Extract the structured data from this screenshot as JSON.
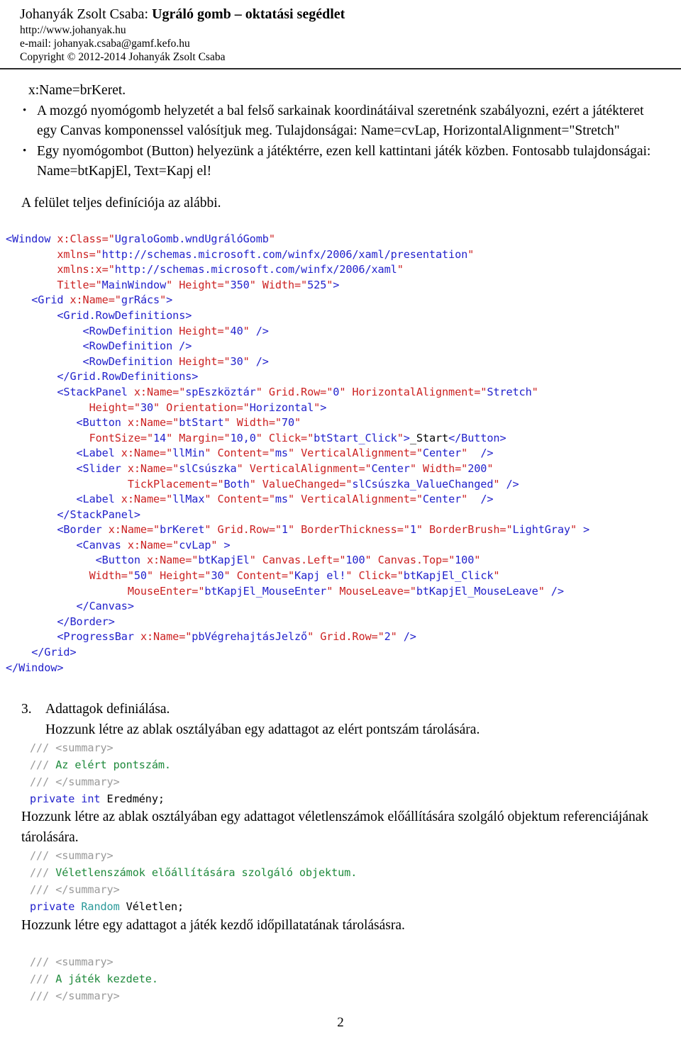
{
  "header": {
    "title_normal": "Johanyák Zsolt Csaba: ",
    "title_bold": "Ugráló gomb – oktatási segédlet",
    "website": "http://www.johanyak.hu",
    "email": "e-mail: johanyak.csaba@gamf.kefo.hu",
    "copyright": "Copyright © 2012-2014 Johanyák Zsolt Csaba"
  },
  "body": {
    "lead_line": "x:Name=brKeret.",
    "bullets": [
      "A mozgó nyomógomb helyzetét a bal felső sarkainak koordinátáival szeretnénk szabályozni, ezért a játékteret egy Canvas komponenssel valósítjuk meg. Tulajdonságai: Name=cvLap, HorizontalAlignment=\"Stretch\"",
      "Egy nyomógombot (Button) helyezünk a játéktérre, ezen kell kattintani játék közben. Fontosabb tulajdonságai: Name=btKapjEl, Text=Kapj el!"
    ],
    "after_bullets": "A felület teljes definíciója az alábbi."
  },
  "xaml": {
    "lines": [
      [
        [
          "tag",
          "<Window "
        ],
        [
          "attr",
          "x:Class=\""
        ],
        [
          "val",
          "UgraloGomb.wndUgrálóGomb"
        ],
        [
          "attr",
          "\""
        ]
      ],
      [
        [
          "plain",
          "        "
        ],
        [
          "attr",
          "xmlns=\""
        ],
        [
          "val",
          "http://schemas.microsoft.com/winfx/2006/xaml/presentation"
        ],
        [
          "attr",
          "\""
        ]
      ],
      [
        [
          "plain",
          "        "
        ],
        [
          "attr",
          "xmlns:x=\""
        ],
        [
          "val",
          "http://schemas.microsoft.com/winfx/2006/xaml"
        ],
        [
          "attr",
          "\""
        ]
      ],
      [
        [
          "plain",
          "        "
        ],
        [
          "attr",
          "Title=\""
        ],
        [
          "val",
          "MainWindow"
        ],
        [
          "attr",
          "\" "
        ],
        [
          "attr",
          "Height=\""
        ],
        [
          "val",
          "350"
        ],
        [
          "attr",
          "\" "
        ],
        [
          "attr",
          "Width=\""
        ],
        [
          "val",
          "525"
        ],
        [
          "attr",
          "\""
        ],
        [
          "tag",
          ">"
        ]
      ],
      [
        [
          "plain",
          "    "
        ],
        [
          "tag",
          "<Grid "
        ],
        [
          "attr",
          "x:Name=\""
        ],
        [
          "val",
          "grRács"
        ],
        [
          "attr",
          "\""
        ],
        [
          "tag",
          ">"
        ]
      ],
      [
        [
          "plain",
          "        "
        ],
        [
          "tag",
          "<Grid.RowDefinitions>"
        ]
      ],
      [
        [
          "plain",
          "            "
        ],
        [
          "tag",
          "<RowDefinition "
        ],
        [
          "attr",
          "Height=\""
        ],
        [
          "val",
          "40"
        ],
        [
          "attr",
          "\" "
        ],
        [
          "tag",
          "/>"
        ]
      ],
      [
        [
          "plain",
          "            "
        ],
        [
          "tag",
          "<RowDefinition />"
        ]
      ],
      [
        [
          "plain",
          "            "
        ],
        [
          "tag",
          "<RowDefinition "
        ],
        [
          "attr",
          "Height=\""
        ],
        [
          "val",
          "30"
        ],
        [
          "attr",
          "\" "
        ],
        [
          "tag",
          "/>"
        ]
      ],
      [
        [
          "plain",
          "        "
        ],
        [
          "tag",
          "</Grid.RowDefinitions>"
        ]
      ],
      [
        [
          "plain",
          "        "
        ],
        [
          "tag",
          "<StackPanel "
        ],
        [
          "attr",
          "x:Name=\""
        ],
        [
          "val",
          "spEszköztár"
        ],
        [
          "attr",
          "\" "
        ],
        [
          "attr",
          "Grid.Row=\""
        ],
        [
          "val",
          "0"
        ],
        [
          "attr",
          "\" "
        ],
        [
          "attr",
          "HorizontalAlignment=\""
        ],
        [
          "val",
          "Stretch"
        ],
        [
          "attr",
          "\""
        ]
      ],
      [
        [
          "plain",
          "             "
        ],
        [
          "attr",
          "Height=\""
        ],
        [
          "val",
          "30"
        ],
        [
          "attr",
          "\" "
        ],
        [
          "attr",
          "Orientation=\""
        ],
        [
          "val",
          "Horizontal"
        ],
        [
          "attr",
          "\""
        ],
        [
          "tag",
          ">"
        ]
      ],
      [
        [
          "plain",
          "           "
        ],
        [
          "tag",
          "<Button "
        ],
        [
          "attr",
          "x:Name=\""
        ],
        [
          "val",
          "btStart"
        ],
        [
          "attr",
          "\" "
        ],
        [
          "attr",
          "Width=\""
        ],
        [
          "val",
          "70"
        ],
        [
          "attr",
          "\""
        ]
      ],
      [
        [
          "plain",
          "             "
        ],
        [
          "attr",
          "FontSize=\""
        ],
        [
          "val",
          "14"
        ],
        [
          "attr",
          "\" "
        ],
        [
          "attr",
          "Margin=\""
        ],
        [
          "val",
          "10,0"
        ],
        [
          "attr",
          "\" "
        ],
        [
          "attr",
          "Click=\""
        ],
        [
          "val",
          "btStart_Click"
        ],
        [
          "attr",
          "\""
        ],
        [
          "tag",
          ">"
        ],
        [
          "txt",
          "_Start"
        ],
        [
          "tag",
          "</Button>"
        ]
      ],
      [
        [
          "plain",
          "           "
        ],
        [
          "tag",
          "<Label "
        ],
        [
          "attr",
          "x:Name=\""
        ],
        [
          "val",
          "llMin"
        ],
        [
          "attr",
          "\" "
        ],
        [
          "attr",
          "Content=\""
        ],
        [
          "val",
          "ms"
        ],
        [
          "attr",
          "\" "
        ],
        [
          "attr",
          "VerticalAlignment=\""
        ],
        [
          "val",
          "Center"
        ],
        [
          "attr",
          "\"  "
        ],
        [
          "tag",
          "/>"
        ]
      ],
      [
        [
          "plain",
          "           "
        ],
        [
          "tag",
          "<Slider "
        ],
        [
          "attr",
          "x:Name=\""
        ],
        [
          "val",
          "slCsúszka"
        ],
        [
          "attr",
          "\" "
        ],
        [
          "attr",
          "VerticalAlignment=\""
        ],
        [
          "val",
          "Center"
        ],
        [
          "attr",
          "\" "
        ],
        [
          "attr",
          "Width=\""
        ],
        [
          "val",
          "200"
        ],
        [
          "attr",
          "\""
        ]
      ],
      [
        [
          "plain",
          "                   "
        ],
        [
          "attr",
          "TickPlacement=\""
        ],
        [
          "val",
          "Both"
        ],
        [
          "attr",
          "\" "
        ],
        [
          "attr",
          "ValueChanged=\""
        ],
        [
          "val",
          "slCsúszka_ValueChanged"
        ],
        [
          "attr",
          "\" "
        ],
        [
          "tag",
          "/>"
        ]
      ],
      [
        [
          "plain",
          "           "
        ],
        [
          "tag",
          "<Label "
        ],
        [
          "attr",
          "x:Name=\""
        ],
        [
          "val",
          "llMax"
        ],
        [
          "attr",
          "\" "
        ],
        [
          "attr",
          "Content=\""
        ],
        [
          "val",
          "ms"
        ],
        [
          "attr",
          "\" "
        ],
        [
          "attr",
          "VerticalAlignment=\""
        ],
        [
          "val",
          "Center"
        ],
        [
          "attr",
          "\"  "
        ],
        [
          "tag",
          "/>"
        ]
      ],
      [
        [
          "plain",
          "        "
        ],
        [
          "tag",
          "</StackPanel>"
        ]
      ],
      [
        [
          "plain",
          "        "
        ],
        [
          "tag",
          "<Border "
        ],
        [
          "attr",
          "x:Name=\""
        ],
        [
          "val",
          "brKeret"
        ],
        [
          "attr",
          "\" "
        ],
        [
          "attr",
          "Grid.Row=\""
        ],
        [
          "val",
          "1"
        ],
        [
          "attr",
          "\" "
        ],
        [
          "attr",
          "BorderThickness=\""
        ],
        [
          "val",
          "1"
        ],
        [
          "attr",
          "\" "
        ],
        [
          "attr",
          "BorderBrush=\""
        ],
        [
          "val",
          "LightGray"
        ],
        [
          "attr",
          "\" "
        ],
        [
          "tag",
          ">"
        ]
      ],
      [
        [
          "plain",
          "           "
        ],
        [
          "tag",
          "<Canvas "
        ],
        [
          "attr",
          "x:Name=\""
        ],
        [
          "val",
          "cvLap"
        ],
        [
          "attr",
          "\" "
        ],
        [
          "tag",
          ">"
        ]
      ],
      [
        [
          "plain",
          "              "
        ],
        [
          "tag",
          "<Button "
        ],
        [
          "attr",
          "x:Name=\""
        ],
        [
          "val",
          "btKapjEl"
        ],
        [
          "attr",
          "\" "
        ],
        [
          "attr",
          "Canvas.Left=\""
        ],
        [
          "val",
          "100"
        ],
        [
          "attr",
          "\" "
        ],
        [
          "attr",
          "Canvas.Top=\""
        ],
        [
          "val",
          "100"
        ],
        [
          "attr",
          "\""
        ]
      ],
      [
        [
          "plain",
          "             "
        ],
        [
          "attr",
          "Width=\""
        ],
        [
          "val",
          "50"
        ],
        [
          "attr",
          "\" "
        ],
        [
          "attr",
          "Height=\""
        ],
        [
          "val",
          "30"
        ],
        [
          "attr",
          "\" "
        ],
        [
          "attr",
          "Content=\""
        ],
        [
          "val",
          "Kapj el!"
        ],
        [
          "attr",
          "\" "
        ],
        [
          "attr",
          "Click=\""
        ],
        [
          "val",
          "btKapjEl_Click"
        ],
        [
          "attr",
          "\""
        ]
      ],
      [
        [
          "plain",
          "                   "
        ],
        [
          "attr",
          "MouseEnter=\""
        ],
        [
          "val",
          "btKapjEl_MouseEnter"
        ],
        [
          "attr",
          "\" "
        ],
        [
          "attr",
          "MouseLeave=\""
        ],
        [
          "val",
          "btKapjEl_MouseLeave"
        ],
        [
          "attr",
          "\" "
        ],
        [
          "tag",
          "/>"
        ]
      ],
      [
        [
          "plain",
          "           "
        ],
        [
          "tag",
          "</Canvas>"
        ]
      ],
      [
        [
          "plain",
          "        "
        ],
        [
          "tag",
          "</Border>"
        ]
      ],
      [
        [
          "plain",
          "        "
        ],
        [
          "tag",
          "<ProgressBar "
        ],
        [
          "attr",
          "x:Name=\""
        ],
        [
          "val",
          "pbVégrehajtásJelző"
        ],
        [
          "attr",
          "\" "
        ],
        [
          "attr",
          "Grid.Row=\""
        ],
        [
          "val",
          "2"
        ],
        [
          "attr",
          "\" "
        ],
        [
          "tag",
          "/>"
        ]
      ],
      [
        [
          "plain",
          "    "
        ],
        [
          "tag",
          "</Grid>"
        ]
      ],
      [
        [
          "tag",
          "</Window>"
        ]
      ]
    ]
  },
  "section3": {
    "number": "3.",
    "title": "Adattagok definiálása.",
    "line1": "Hozzunk létre az ablak osztályában egy adattagot az elért pontszám tárolására.",
    "code1": [
      [
        [
          "cmt",
          "/// "
        ],
        [
          "cmt",
          "<summary>"
        ]
      ],
      [
        [
          "cmt",
          "/// "
        ],
        [
          "cmtg",
          "Az elért pontszám."
        ]
      ],
      [
        [
          "cmt",
          "/// "
        ],
        [
          "cmt",
          "</summary>"
        ]
      ],
      [
        [
          "kw",
          "private int "
        ],
        [
          "id",
          "Eredmény;"
        ]
      ]
    ],
    "line2": "Hozzunk létre az ablak osztályában egy adattagot véletlenszámok előállítására szolgáló objektum referenciájának tárolására.",
    "code2": [
      [
        [
          "cmt",
          "/// "
        ],
        [
          "cmt",
          "<summary>"
        ]
      ],
      [
        [
          "cmt",
          "/// "
        ],
        [
          "cmtg",
          "Véletlenszámok előállítására szolgáló objektum."
        ]
      ],
      [
        [
          "cmt",
          "/// "
        ],
        [
          "cmt",
          "</summary>"
        ]
      ],
      [
        [
          "kw",
          "private "
        ],
        [
          "type",
          "Random "
        ],
        [
          "id",
          "Véletlen;"
        ]
      ]
    ],
    "line3": "Hozzunk létre egy adattagot a játék kezdő időpillatatának tárolásásra.",
    "code3": [
      [
        [
          "cmt",
          "/// "
        ],
        [
          "cmt",
          "<summary>"
        ]
      ],
      [
        [
          "cmt",
          "/// "
        ],
        [
          "cmtg",
          "A játék kezdete."
        ]
      ],
      [
        [
          "cmt",
          "/// "
        ],
        [
          "cmt",
          "</summary>"
        ]
      ]
    ]
  },
  "footer": {
    "page_number": "2"
  }
}
